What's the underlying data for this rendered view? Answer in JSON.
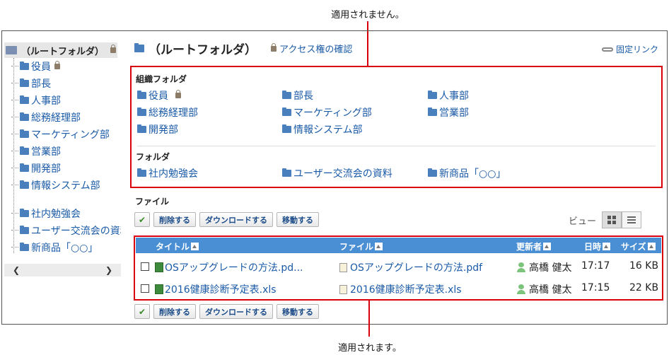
{
  "annotations": {
    "top": "適用されません。",
    "bottom": "適用されます。"
  },
  "tree": {
    "root": "（ルートフォルダ）",
    "items": [
      "役員",
      "部長",
      "人事部",
      "総務経理部",
      "マーケティング部",
      "営業部",
      "開発部",
      "情報システム部"
    ],
    "items2": [
      "社内勉強会",
      "ユーザー交流会の資料",
      "新商品「○○」"
    ]
  },
  "header": {
    "title": "（ルートフォルダ）",
    "access_link": "アクセス権の確認",
    "permalink": "固定リンク"
  },
  "org_folders": {
    "label": "組織フォルダ",
    "items": [
      "役員",
      "部長",
      "人事部",
      "総務経理部",
      "マーケティング部",
      "営業部",
      "開発部",
      "情報システム部"
    ]
  },
  "folders": {
    "label": "フォルダ",
    "items": [
      "社内勉強会",
      "ユーザー交流会の資料",
      "新商品「○○」"
    ]
  },
  "files": {
    "label": "ファイル",
    "buttons": {
      "check": "✔",
      "delete": "削除する",
      "download": "ダウンロードする",
      "move": "移動する"
    },
    "view_label": "ビュー",
    "columns": {
      "title": "タイトル",
      "file": "ファイル",
      "updater": "更新者",
      "datetime": "日時",
      "size": "サイズ"
    },
    "rows": [
      {
        "title": "OSアップグレードの方法.pd...",
        "file": "OSアップグレードの方法.pdf",
        "updater": "高橋 健太",
        "datetime": "17:17",
        "size": "16 KB"
      },
      {
        "title": "2016健康診断予定表.xls",
        "file": "2016健康診断予定表.xls",
        "updater": "高橋 健太",
        "datetime": "17:15",
        "size": "22 KB"
      }
    ]
  },
  "colors": {
    "accent_red": "#d8000c",
    "link_blue": "#1a5aa6",
    "header_blue": "#4a8fd4"
  }
}
